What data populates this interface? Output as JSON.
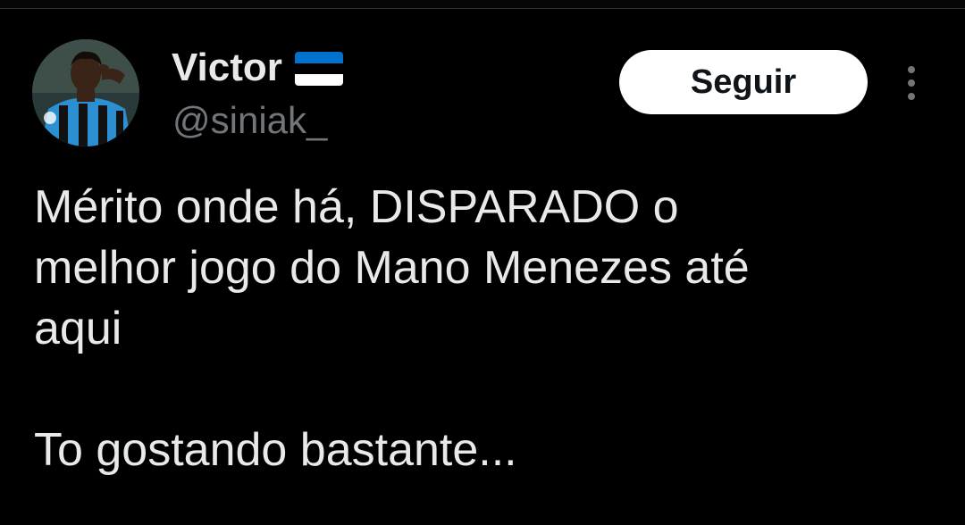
{
  "tweet": {
    "display_name": "Victor",
    "flag_icon": "estonia-flag-icon",
    "flag_colors": [
      "#0072ce",
      "#000000",
      "#ffffff"
    ],
    "handle": "@siniak_",
    "follow_label": "Seguir",
    "more_icon": "more-vertical-icon",
    "text": "Mérito onde há, DISPARADO o\nmelhor jogo do Mano Menezes até\naqui\n\nTo gostando bastante..."
  },
  "colors": {
    "background": "#000000",
    "primary_text": "#e7e9ea",
    "secondary_text": "#71767b",
    "button_bg": "#ffffff",
    "button_text": "#0f1419"
  }
}
